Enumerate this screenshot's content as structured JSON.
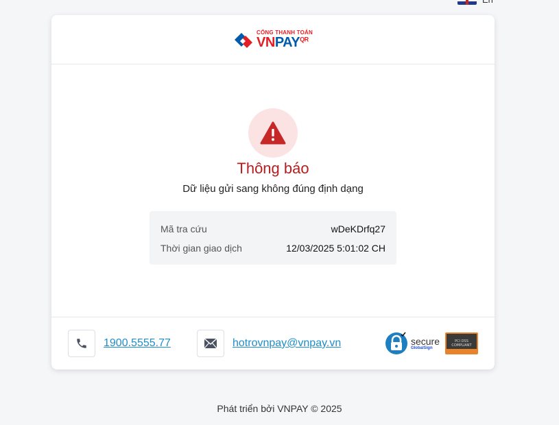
{
  "language": {
    "label": "En"
  },
  "logo": {
    "top_text": "CỔNG THANH TOÁN",
    "vn": "VN",
    "pay": "PAY",
    "qr": "QR"
  },
  "notice": {
    "title": "Thông báo",
    "message": "Dữ liệu gửi sang không đúng định dạng"
  },
  "info": {
    "rows": [
      {
        "label": "Mã tra cứu",
        "value": "wDeKDrfq27"
      },
      {
        "label": "Thời gian giao dịch",
        "value": "12/03/2025 5:01:02 CH"
      }
    ]
  },
  "contact": {
    "phone": "1900.5555.77",
    "email": "hotrovnpay@vnpay.vn"
  },
  "badges": {
    "secure_main": "secure",
    "secure_sub": "GlobalSign",
    "pci_line1": "PCI DSS",
    "pci_line2": "COMPLIANT"
  },
  "footer": {
    "text": "Phát triển bởi VNPAY © 2025"
  },
  "colors": {
    "alert": "#c62828",
    "link": "#1d8ec9",
    "alert_bg": "#fbe3e3"
  }
}
